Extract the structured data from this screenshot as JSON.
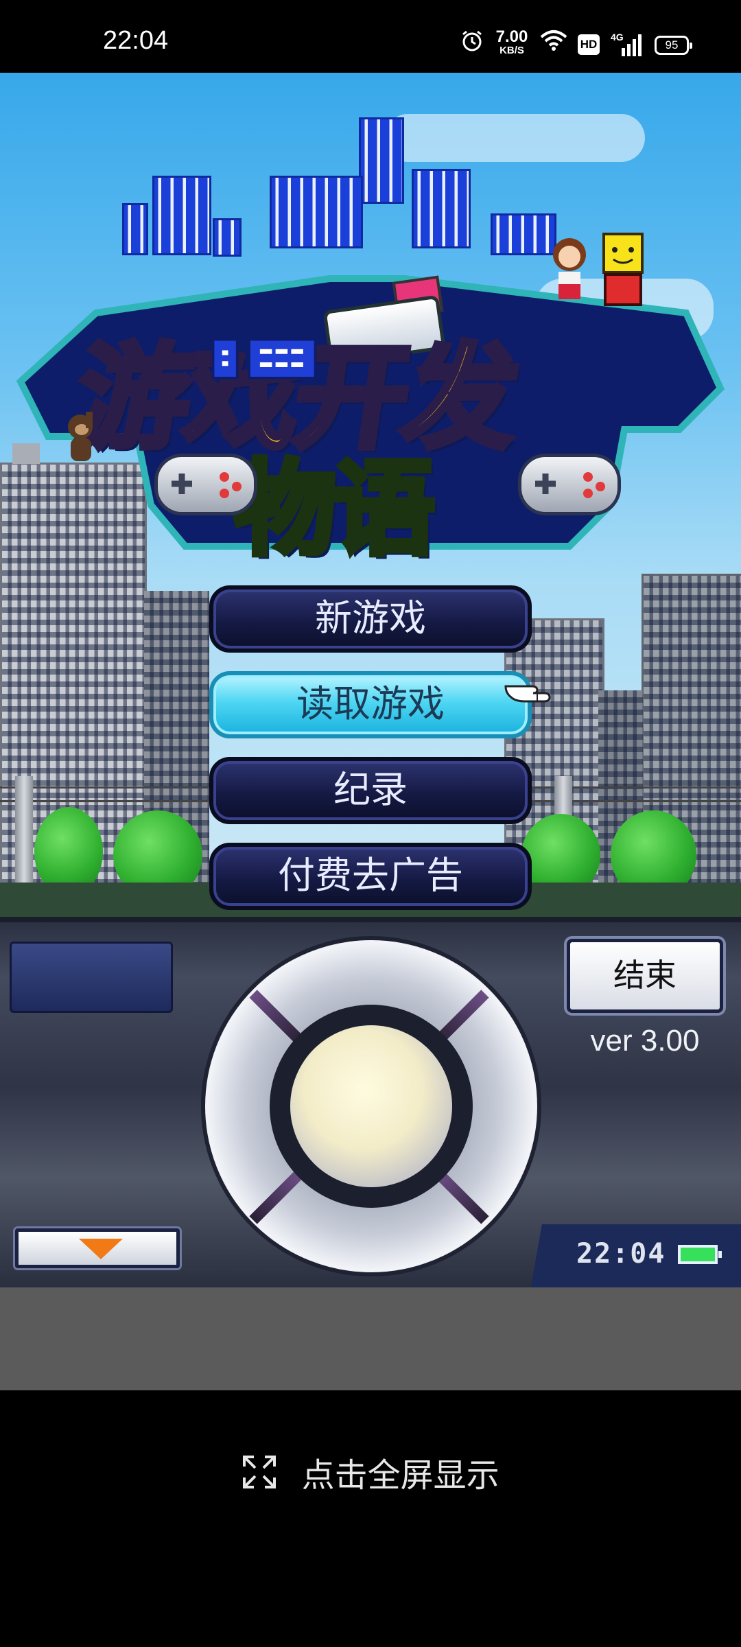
{
  "status_bar": {
    "time": "22:04",
    "net_speed_value": "7.00",
    "net_speed_unit": "KB/S",
    "hd_badge": "HD",
    "network_type": "4G",
    "battery": "95"
  },
  "title_logo": {
    "line1": "游戏开发",
    "line2": "物语"
  },
  "menu": {
    "items": [
      {
        "label": "新游戏"
      },
      {
        "label": "读取游戏"
      },
      {
        "label": "纪录"
      },
      {
        "label": "付费去广告"
      }
    ],
    "selected_index": 1
  },
  "panel": {
    "end_label": "结束",
    "version": "ver 3.00",
    "clock": "22:04"
  },
  "bottom": {
    "fullscreen_label": "点击全屏显示"
  },
  "colors": {
    "selected_button": "#4fd6f3",
    "menu_button": "#151a45",
    "game_battery": "#36e05a",
    "down_arrow": "#f27a16"
  }
}
